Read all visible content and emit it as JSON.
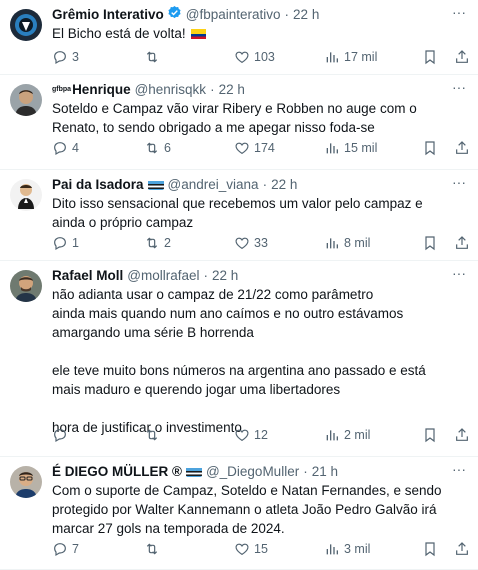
{
  "colors": {
    "text": "#0f1419",
    "muted": "#536471",
    "verified": "#1d9bf0",
    "divider": "#eff3f4"
  },
  "tweets": [
    {
      "name": "Grêmio Interativo",
      "verified_icon": "verified-badge-icon",
      "handle": "@fbpainterativo",
      "time": "22 h",
      "text": "El Bicho está de volta! ",
      "inline_emoji": "colombia-flag-icon",
      "replies": "3",
      "retweets": "",
      "likes": "103",
      "views": "17 mil"
    },
    {
      "name_prefix": "gfbpa",
      "name": "Henrique",
      "handle": "@henrisqkk",
      "time": "22 h",
      "text": "Soteldo e Campaz vão virar Ribery e Robben no auge com o Renato, to sendo obrigado a me apegar nisso foda-se",
      "replies": "4",
      "retweets": "6",
      "likes": "174",
      "views": "15 mil"
    },
    {
      "name": "Pai da Isadora",
      "name_flag": "gremio-flag-icon",
      "handle": "@andrei_viana",
      "time": "22 h",
      "text": "Dito isso sensacional que recebemos um valor pelo campaz e ainda o próprio campaz",
      "replies": "1",
      "retweets": "2",
      "likes": "33",
      "views": "8 mil"
    },
    {
      "name": "Rafael Moll",
      "handle": "@mollrafael",
      "time": "22 h",
      "text": "não adianta usar o campaz de 21/22 como parâmetro\nainda mais quando num ano caímos e no outro estávamos amargando uma série B horrenda\n\nele teve muito bons números na argentina ano passado e está mais maduro e querendo jogar uma libertadores\n\nhora de justificar o investimento",
      "replies": "",
      "retweets": "",
      "likes": "12",
      "views": "2 mil"
    },
    {
      "name": "É DIEGO MÜLLER ®",
      "name_flag": "gremio-flag-icon",
      "handle": "@_DiegoMuller",
      "time": "21 h",
      "text": "Com o suporte de Campaz, Soteldo e Natan Fernandes, e sendo protegido por Walter Kannemann o atleta João Pedro Galvão irá marcar 27 gols na temporada de 2024.",
      "replies": "7",
      "retweets": "",
      "likes": "15",
      "views": "3 mil"
    }
  ]
}
